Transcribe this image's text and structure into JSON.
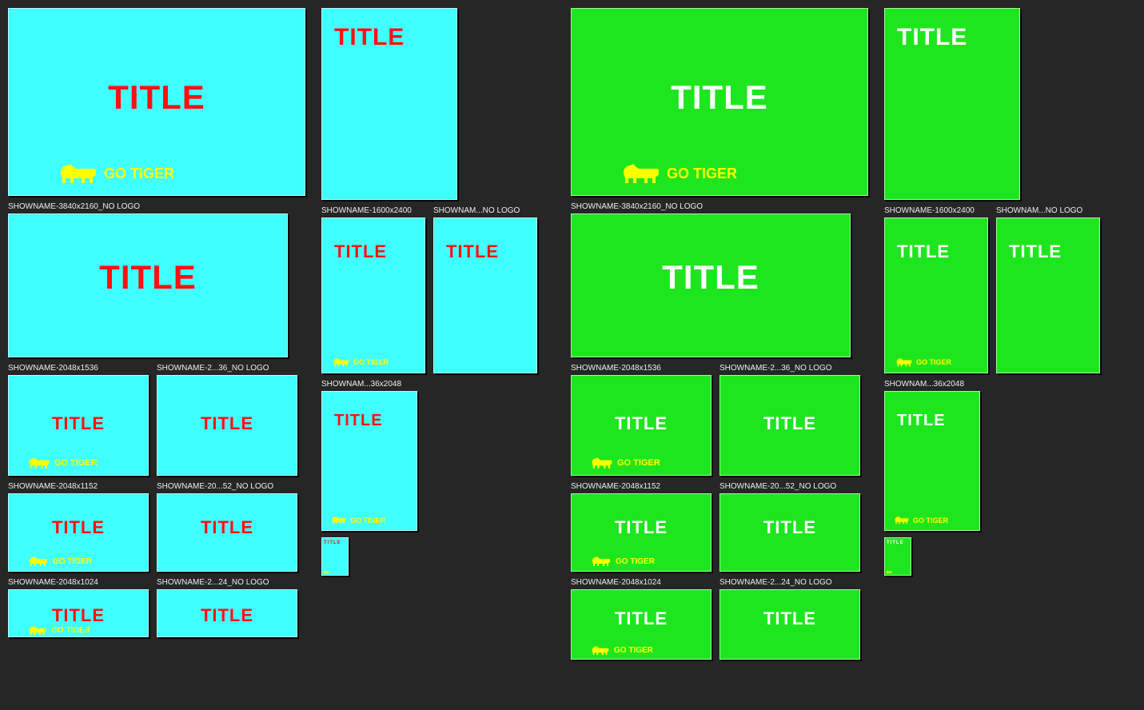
{
  "title": "TITLE",
  "tagline": "GO TIGER",
  "labels": {
    "l3840nl": "SHOWNAME-3840x2160_NO LOGO",
    "l2048x1536": "SHOWNAME-2048x1536",
    "l2_36nl": "SHOWNAME-2...36_NO LOGO",
    "l2048x1152": "SHOWNAME-2048x1152",
    "l20_52nl": "SHOWNAME-20...52_NO LOGO",
    "l2048x1024": "SHOWNAME-2048x1024",
    "l2_24nl": "SHOWNAME-2...24_NO LOGO",
    "l1600x2400": "SHOWNAME-1600x2400",
    "lNoLogo": "SHOWNAM...NO LOGO",
    "l36x2048": "SHOWNAM...36x2048"
  }
}
